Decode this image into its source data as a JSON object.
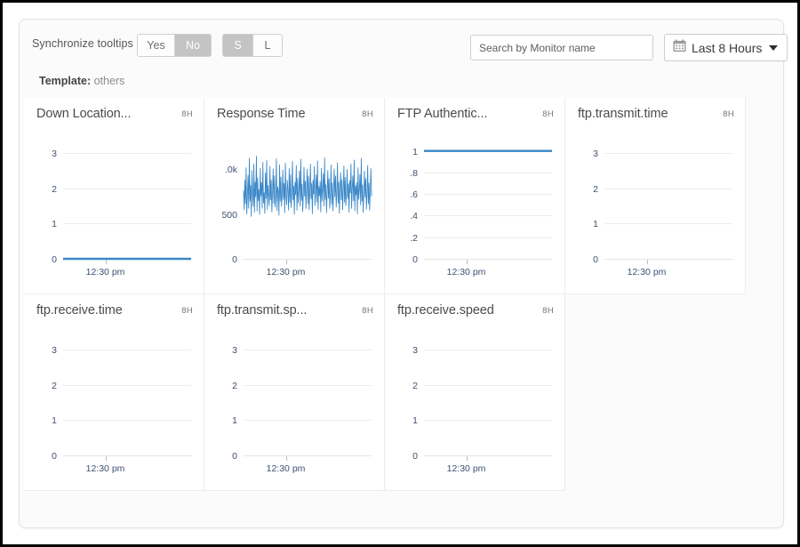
{
  "toolbar": {
    "sync_label": "Synchronize tooltips",
    "sync_yes": "Yes",
    "sync_no": "No",
    "size_small": "S",
    "size_large": "L",
    "sync_selected": "No",
    "size_selected": "S",
    "search_placeholder": "Search by Monitor name",
    "search_value": "",
    "range_label": "Last 8 Hours",
    "calendar_icon": "calendar-icon",
    "caret_icon": "chevron-down-icon"
  },
  "template": {
    "label": "Template:",
    "value": "others"
  },
  "colors": {
    "series": "#3a87c8",
    "gridline": "#ededed",
    "tick_text": "#3f5073",
    "segment_active_bg": "#c4c4c4",
    "card_bg": "#fbfbfb",
    "panel_bg": "#ffffff"
  },
  "chart_data": [
    {
      "type": "line",
      "title": "Down Location...",
      "badge": "8H",
      "xlabel": "",
      "ylabel": "",
      "yticks": [
        "3",
        "2",
        "1",
        "0"
      ],
      "ytick_values": [
        3,
        2,
        1,
        0
      ],
      "ylim": [
        0,
        3.3
      ],
      "xticks": [
        "12:30 pm"
      ],
      "grid": true,
      "series": [
        {
          "name": "Down Location",
          "constant": 0,
          "values": [
            0,
            0,
            0,
            0,
            0,
            0,
            0,
            0,
            0,
            0,
            0,
            0
          ]
        }
      ]
    },
    {
      "type": "line",
      "title": "Response Time",
      "badge": "8H",
      "xlabel": "",
      "ylabel": "",
      "yticks": [
        ".0k",
        "500",
        "0"
      ],
      "ytick_values": [
        1000,
        500,
        0
      ],
      "ylim": [
        0,
        1300
      ],
      "xticks": [
        "12:30 pm"
      ],
      "grid": false,
      "series": [
        {
          "name": "Response Time",
          "values": [
            760,
            545,
            880,
            610,
            1020,
            498,
            705,
            935,
            560,
            1125,
            640,
            820,
            470,
            990,
            725,
            585,
            1060,
            515,
            860,
            690,
            1150,
            530,
            905,
            645,
            775,
            492,
            1015,
            700,
            855,
            562,
            1080,
            620,
            740,
            505,
            960,
            672,
            1100,
            548,
            825,
            715,
            590,
            1035,
            655,
            880,
            520,
            745,
            1005,
            612,
            930,
            575,
            690,
            1120,
            535,
            805,
            760,
            482,
            1050,
            640,
            915,
            585,
            720,
            995,
            660,
            845,
            512,
            1070,
            705,
            600,
            880,
            752,
            540,
            1010,
            625,
            940,
            570,
            735,
            1090,
            655,
            815,
            495,
            860,
            712,
            1045,
            538,
            900,
            620,
            770,
            985,
            583,
            1115,
            648,
            835,
            525,
            742,
            1025,
            695,
            870,
            558,
            790,
            1005,
            612,
            925,
            545,
            735,
            1060,
            668,
            845,
            500,
            880,
            720,
            1035,
            592,
            755,
            940,
            630,
            1095,
            548,
            810,
            700,
            865,
            520,
            1015,
            642,
            775,
            955,
            585,
            1130,
            660,
            830,
            510,
            745,
            990,
            672,
            895,
            560,
            720,
            1050,
            605,
            850,
            532,
            780,
            1005,
            690,
            925,
            575,
            740,
            1075,
            618,
            860,
            505,
            800,
            965,
            655,
            885,
            545,
            760,
            1040,
            628,
            912,
            590,
            725,
            1000,
            670,
            840,
            518,
            875,
            735,
            1060,
            560,
            790,
            930,
            645,
            1105,
            535,
            820,
            710,
            855,
            500,
            1020,
            662,
            768,
            945,
            598,
            1125,
            638,
            826,
            515,
            752,
            982,
            685,
            898,
            552,
            730,
            1045,
            610,
            848,
            540,
            776,
            1008,
            698
          ]
        }
      ]
    },
    {
      "type": "line",
      "title": "FTP Authentic...",
      "badge": "8H",
      "xlabel": "",
      "ylabel": "",
      "yticks": [
        "1",
        ".8",
        ".6",
        ".4",
        ".2",
        "0"
      ],
      "ytick_values": [
        1,
        0.8,
        0.6,
        0.4,
        0.2,
        0
      ],
      "ylim": [
        0,
        1.08
      ],
      "xticks": [
        "12:30 pm"
      ],
      "grid": true,
      "series": [
        {
          "name": "FTP Authentication",
          "constant": 1,
          "values": [
            1,
            1,
            1,
            1,
            1,
            1,
            1,
            1,
            1,
            1,
            1,
            1
          ]
        }
      ]
    },
    {
      "type": "line",
      "title": "ftp.transmit.time",
      "badge": "8H",
      "xlabel": "",
      "ylabel": "",
      "yticks": [
        "3",
        "2",
        "1",
        "0"
      ],
      "ytick_values": [
        3,
        2,
        1,
        0
      ],
      "ylim": [
        0,
        3.3
      ],
      "xticks": [
        "12:30 pm"
      ],
      "grid": true,
      "series": []
    },
    {
      "type": "line",
      "title": "ftp.receive.time",
      "badge": "8H",
      "xlabel": "",
      "ylabel": "",
      "yticks": [
        "3",
        "2",
        "1",
        "0"
      ],
      "ytick_values": [
        3,
        2,
        1,
        0
      ],
      "ylim": [
        0,
        3.3
      ],
      "xticks": [
        "12:30 pm"
      ],
      "grid": true,
      "series": []
    },
    {
      "type": "line",
      "title": "ftp.transmit.sp...",
      "badge": "8H",
      "xlabel": "",
      "ylabel": "",
      "yticks": [
        "3",
        "2",
        "1",
        "0"
      ],
      "ytick_values": [
        3,
        2,
        1,
        0
      ],
      "ylim": [
        0,
        3.3
      ],
      "xticks": [
        "12:30 pm"
      ],
      "grid": true,
      "series": []
    },
    {
      "type": "line",
      "title": "ftp.receive.speed",
      "badge": "8H",
      "xlabel": "",
      "ylabel": "",
      "yticks": [
        "3",
        "2",
        "1",
        "0"
      ],
      "ytick_values": [
        3,
        2,
        1,
        0
      ],
      "ylim": [
        0,
        3.3
      ],
      "xticks": [
        "12:30 pm"
      ],
      "grid": true,
      "series": []
    }
  ]
}
